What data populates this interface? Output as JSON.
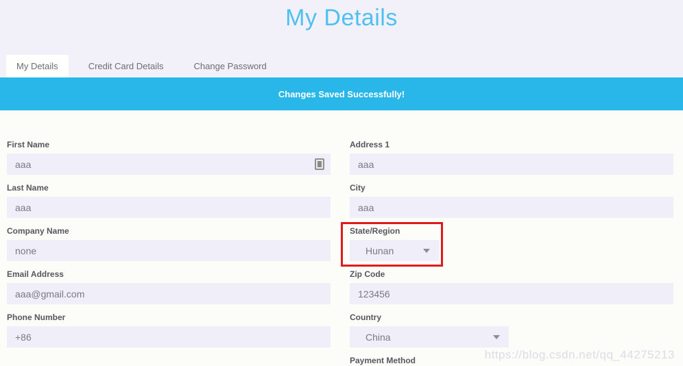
{
  "page": {
    "title": "My Details"
  },
  "tabs": [
    {
      "label": "My Details",
      "active": true
    },
    {
      "label": "Credit Card Details",
      "active": false
    },
    {
      "label": "Change Password",
      "active": false
    }
  ],
  "banner": {
    "message": "Changes Saved Successfully!"
  },
  "form": {
    "left": [
      {
        "label": "First Name",
        "value": "aaa"
      },
      {
        "label": "Last Name",
        "value": "aaa"
      },
      {
        "label": "Company Name",
        "value": "none"
      },
      {
        "label": "Email Address",
        "value": "aaa@gmail.com"
      },
      {
        "label": "Phone Number",
        "value": "+86"
      }
    ],
    "right": [
      {
        "label": "Address 1",
        "value": "aaa"
      },
      {
        "label": "City",
        "value": "aaa"
      },
      {
        "label": "State/Region",
        "value": "Hunan",
        "type": "select",
        "highlighted": true
      },
      {
        "label": "Zip Code",
        "value": "123456"
      },
      {
        "label": "Country",
        "value": "China",
        "type": "select"
      },
      {
        "label": "Payment Method"
      }
    ]
  },
  "icons": {
    "autofill": "autofill-extension-icon",
    "dropdown": "chevron-down-icon"
  },
  "colors": {
    "banner": "#29b6e8",
    "title": "#4ec1f1",
    "highlight": "#e01a1a",
    "input_bg": "#f0eef9",
    "header_bg": "#f2f0f8"
  },
  "watermark": "https://blog.csdn.net/qq_44275213"
}
